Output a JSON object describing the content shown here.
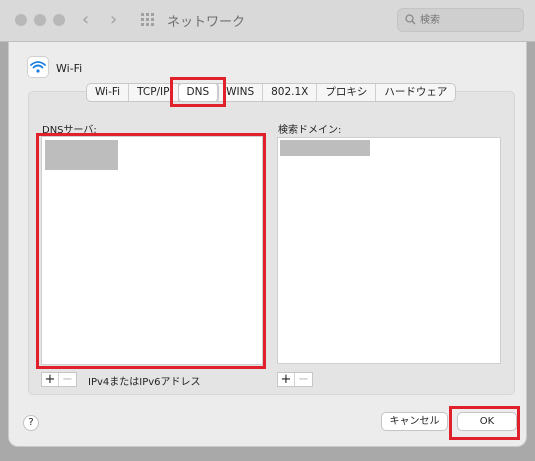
{
  "window": {
    "title": "ネットワーク",
    "search_placeholder": "検索"
  },
  "interface": {
    "name": "Wi-Fi"
  },
  "tabs": [
    {
      "label": "Wi-Fi"
    },
    {
      "label": "TCP/IP"
    },
    {
      "label": "DNS",
      "active": true
    },
    {
      "label": "WINS"
    },
    {
      "label": "802.1X"
    },
    {
      "label": "プロキシ"
    },
    {
      "label": "ハードウェア"
    }
  ],
  "dns": {
    "servers_label": "DNSサーバ:",
    "domains_label": "検索ドメイン:",
    "servers_hint": "IPv4またはIPv6アドレス"
  },
  "controls": {
    "plus": "+",
    "minus": "−",
    "help": "?"
  },
  "buttons": {
    "cancel": "キャンセル",
    "ok": "OK"
  },
  "colors": {
    "highlight": "#e0202a",
    "accent_wifi": "#1a7fe0"
  }
}
